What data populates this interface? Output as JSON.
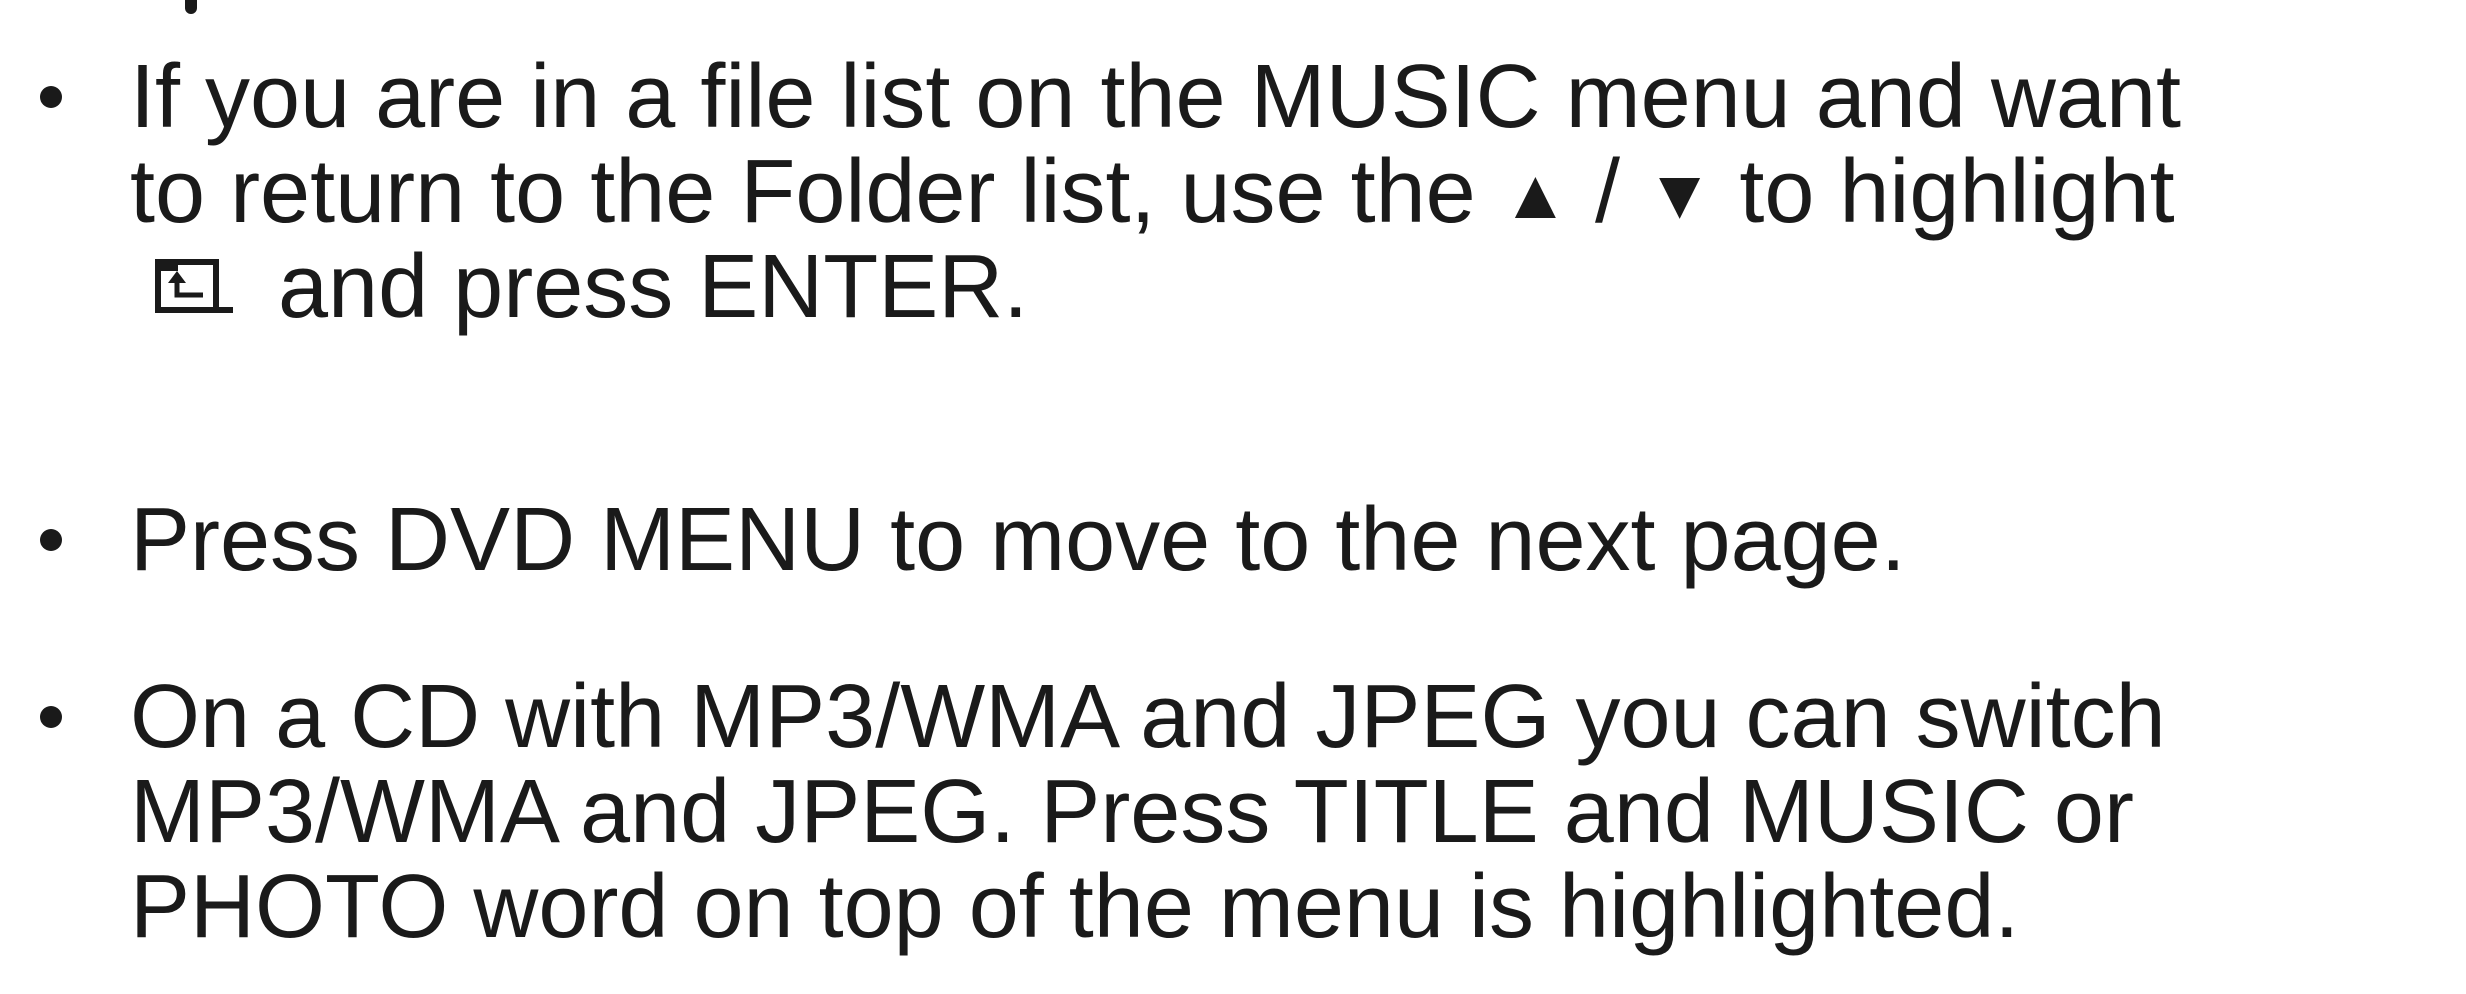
{
  "bullets": [
    {
      "lines": [
        "If you are in a file list on the MUSIC menu and want",
        "to return to the Folder list, use the ",
        " and press ENTER."
      ],
      "up_arrow": "▲",
      "separator": " / ",
      "down_arrow": "▼",
      "after_arrows": " to highlight",
      "icon": "folder-up-icon"
    },
    {
      "lines": [
        "Press DVD MENU to move to the next page."
      ]
    },
    {
      "lines": [
        "On a CD with MP3/WMA and JPEG you can switch",
        "MP3/WMA and JPEG. Press TITLE and MUSIC or",
        "PHOTO word on top of the menu is highlighted."
      ]
    }
  ]
}
